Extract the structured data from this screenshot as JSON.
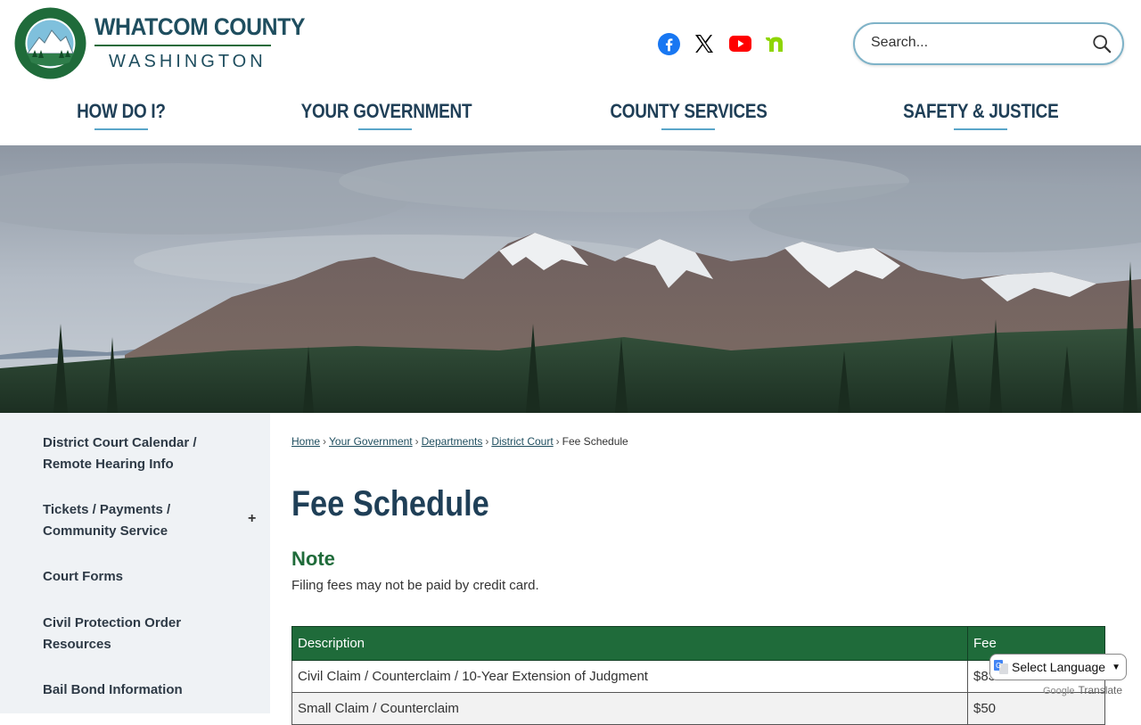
{
  "brand": {
    "line1": "WHATCOM COUNTY",
    "line2": "WASHINGTON",
    "seal_text_top": "WHATCOM COUNTY",
    "seal_text_bottom": "WASHINGTON"
  },
  "social": [
    {
      "name": "facebook-icon",
      "color": "#1877f2"
    },
    {
      "name": "x-icon",
      "color": "#000000"
    },
    {
      "name": "youtube-icon",
      "color": "#ff0000"
    },
    {
      "name": "nextdoor-icon",
      "color": "#8ed500"
    }
  ],
  "search": {
    "placeholder": "Search..."
  },
  "nav": [
    {
      "label": "HOW DO I?"
    },
    {
      "label": "YOUR GOVERNMENT"
    },
    {
      "label": "COUNTY SERVICES"
    },
    {
      "label": "SAFETY & JUSTICE"
    }
  ],
  "sidebar": {
    "items": [
      {
        "label": "District Court Calendar / Remote Hearing Info"
      },
      {
        "label": "Tickets / Payments / Community Service",
        "expander": "+"
      },
      {
        "label": "Court Forms"
      },
      {
        "label": "Civil Protection Order Resources"
      },
      {
        "label": "Bail Bond Information"
      }
    ]
  },
  "breadcrumb": {
    "items": [
      "Home",
      "Your Government",
      "Departments",
      "District Court"
    ],
    "current": "Fee Schedule",
    "separator": "›"
  },
  "page": {
    "title": "Fee Schedule",
    "note_heading": "Note",
    "note_text": "Filing fees may not be paid by credit card."
  },
  "table": {
    "headers": [
      "Description",
      "Fee"
    ],
    "rows": [
      {
        "description": "Civil Claim / Counterclaim / 10-Year Extension of Judgment",
        "fee": "$83"
      },
      {
        "description": "Small Claim / Counterclaim",
        "fee": "$50"
      }
    ]
  },
  "translate": {
    "select_label": "Select Language",
    "powered_by": "Google",
    "translate_word": "Translate"
  },
  "colors": {
    "primary_navy": "#1f3f57",
    "accent_green": "#1f6b3a",
    "nav_underline": "#5aa6c9",
    "sidebar_bg": "#eff2f5"
  }
}
